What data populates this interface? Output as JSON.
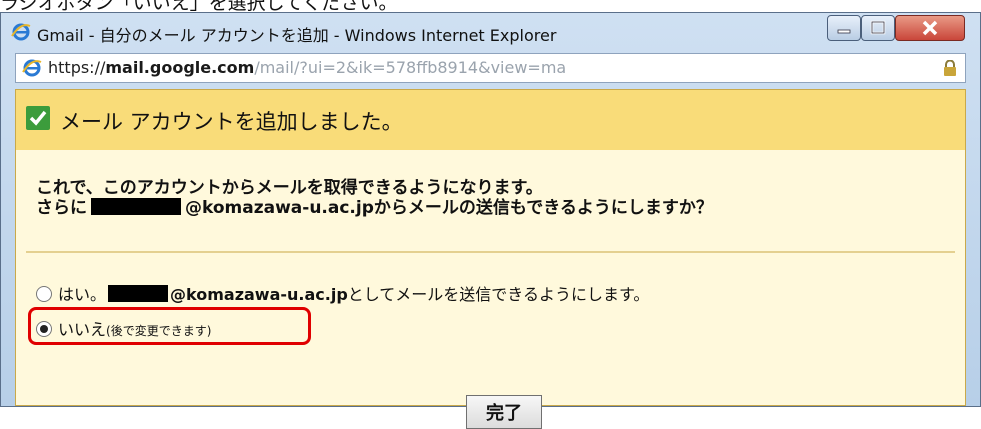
{
  "caption": {
    "text": "ラジオボタン「いいえ」を選択してください。"
  },
  "window": {
    "title": "Gmail - 自分のメール アカウントを追加 - Windows Internet Explorer"
  },
  "address_bar": {
    "scheme": "https://",
    "host": "mail.google.com",
    "path": "/mail/?ui=2&ik=578ffb8914&view=ma"
  },
  "dialog": {
    "header_title": "メール アカウントを追加しました。",
    "message_line1": "これで、このアカウントからメールを取得できるようになります。",
    "message_line2_prefix": "さらに",
    "message_line2_email": "@komazawa-u.ac.jp",
    "message_line2_suffix": "からメールの送信もできるようにしますか？",
    "option_yes_prefix": "はい。",
    "option_yes_email": "@komazawa-u.ac.jp",
    "option_yes_suffix": "としてメールを送信できるようにします。",
    "option_no_label": "いいえ",
    "option_no_note": "(後で変更できます)",
    "option_selected": "no",
    "done_button": "完了"
  },
  "colors": {
    "header": "#f9dc79",
    "content": "#fff9dc",
    "highlight": "#e00000",
    "check": "#3c9c3c"
  }
}
